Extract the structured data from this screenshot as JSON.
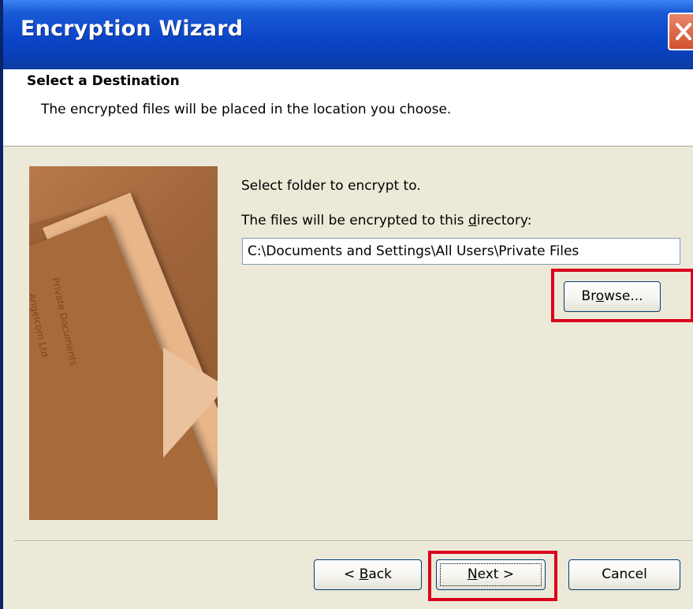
{
  "window": {
    "title": "Encryption Wizard"
  },
  "header": {
    "title": "Select a Destination",
    "description": "The encrypted files will be placed in the location you choose."
  },
  "side_image": {
    "label_1": "Private Documents",
    "label_2": "Angelcom Ltd"
  },
  "main": {
    "prompt": "Select folder to encrypt to.",
    "dir_label_pre": "The files will be encrypted to this ",
    "dir_label_key": "d",
    "dir_label_post": "irectory:",
    "path_value": "C:\\Documents and Settings\\All Users\\Private Files",
    "browse_pre": "Br",
    "browse_key": "o",
    "browse_post": "wse..."
  },
  "footer": {
    "back_pre": "< ",
    "back_key": "B",
    "back_post": "ack",
    "next_key": "N",
    "next_post": "ext >",
    "cancel_label": "Cancel"
  },
  "colors": {
    "highlight": "#d9001b",
    "titlebar": "#0b46c9"
  }
}
